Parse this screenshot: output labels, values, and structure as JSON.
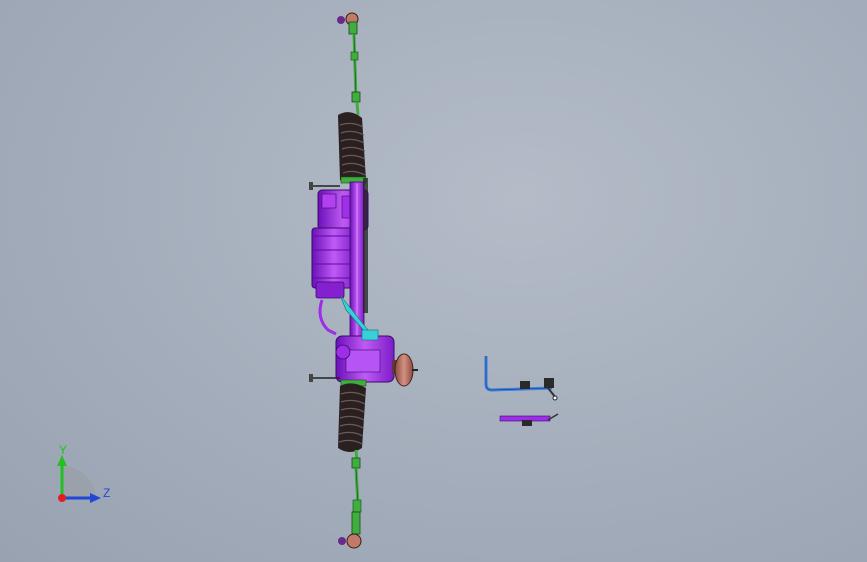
{
  "viewport": {
    "background_top": "#b6bfcb",
    "background_bottom": "#98a2b1"
  },
  "triad": {
    "y_label": "Y",
    "z_label": "Z",
    "y_color": "#22c022",
    "z_color": "#2247d8",
    "origin_color": "#e02020"
  },
  "model": {
    "housing_color": "#9b2ee6",
    "boot_color": "#3a2a2a",
    "tierod_color": "#3fae3f",
    "flange_color": "#c07a6a",
    "bracket_color": "#3a7fe0",
    "accent_color": "#38d0d8"
  }
}
